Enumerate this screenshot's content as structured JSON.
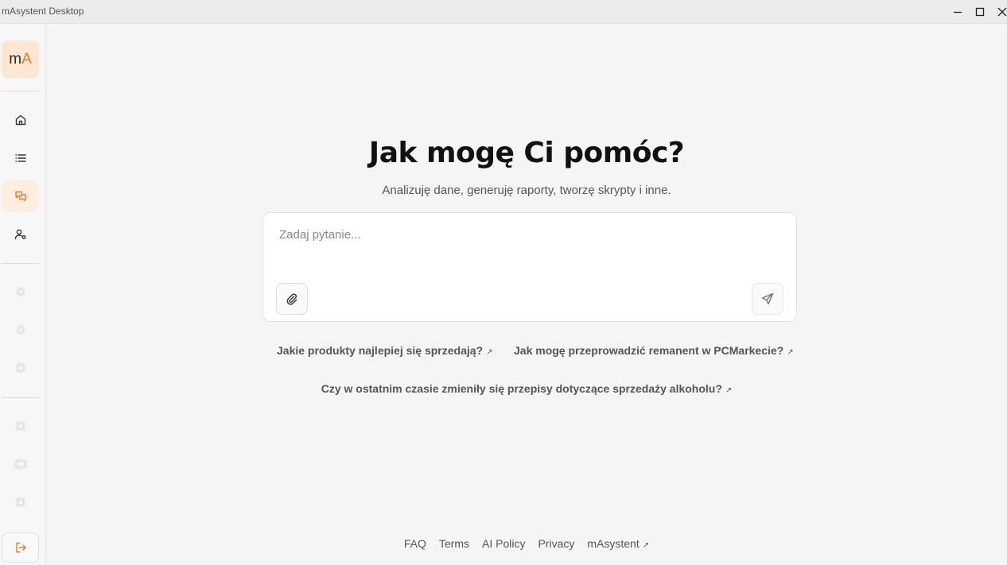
{
  "window": {
    "title": "mAsystent Desktop"
  },
  "sidebar": {
    "logo": {
      "left": "m",
      "right": "A"
    },
    "nav": [
      {
        "name": "home",
        "icon": "home-icon",
        "active": false
      },
      {
        "name": "list",
        "icon": "list-icon",
        "active": false
      },
      {
        "name": "chat",
        "icon": "chat-icon",
        "active": true
      },
      {
        "name": "user-settings",
        "icon": "user-settings-icon",
        "active": false
      }
    ]
  },
  "main": {
    "heading": "Jak mogę Ci pomóc?",
    "subheading": "Analizuję dane, generuję raporty, tworzę skrypty i inne.",
    "input": {
      "placeholder": "Zadaj pytanie...",
      "value": ""
    },
    "suggestions": [
      "Jakie produkty najlepiej się sprzedają?",
      "Jak mogę przeprowadzić remanent w PCMarkecie?",
      "Czy w ostatnim czasie zmieniły się przepisy dotyczące sprzedaży alkoholu?"
    ],
    "suggestion_arrow": "↗"
  },
  "footer": {
    "links": [
      "FAQ",
      "Terms",
      "AI Policy",
      "Privacy",
      "mAsystent"
    ],
    "external_arrow": "↗"
  },
  "colors": {
    "accent": "#e8792f",
    "accent_bg": "#fdeedf",
    "background": "#f5f5f5"
  }
}
